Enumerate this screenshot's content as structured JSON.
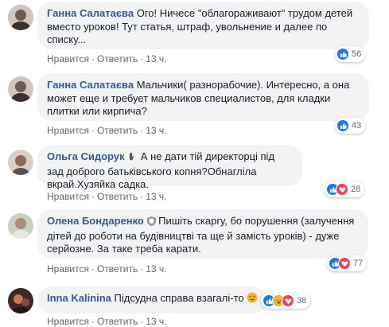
{
  "comments": [
    {
      "author": "Ганна Салатаєва",
      "text": "Ого! Ничесе \"облагораживают\" трудом детей вместо уроков! Тут статья, штраф, увольнение и далее по списку...",
      "like_label": "Нравится",
      "reply_label": "Ответить",
      "time": "13 ч.",
      "reaction_count": "56",
      "reactions": [
        "like"
      ],
      "avatar_color": "#8a7a70"
    },
    {
      "author": "Ганна Салатаєва",
      "text": "Мальчики( разнорабочие). Интересно, а она может еще и требует мальчиков специалистов, для кладки плитки или кирпича?",
      "like_label": "Нравится",
      "reply_label": "Ответить",
      "time": "13 ч.",
      "reaction_count": "43",
      "reactions": [
        "like"
      ],
      "avatar_color": "#8a7a70"
    },
    {
      "author": "Ольга Сидорук",
      "text": "А не дати тій директорці під зад доброго батьківського копня?Обнагліла вкрай.Хузяйка садка.",
      "like_label": "Нравится",
      "reply_label": "Ответить",
      "time": "13 ч.",
      "reaction_count": "28",
      "reactions": [
        "like",
        "love"
      ],
      "avatar_color": "#b0a08f"
    },
    {
      "author": "Олена Бондаренко",
      "text": "Пишіть скаргу, бо порушення (залучення дітей до роботи на будівництві та ще й замість уроків) - дуже серйозне. За таке треба карати.",
      "like_label": "Нравится",
      "reply_label": "Ответить",
      "time": "13 ч.",
      "reaction_count": "77",
      "reactions": [
        "like",
        "love"
      ],
      "avatar_color": "#9aa58a"
    },
    {
      "author": "Inna Kalinina",
      "text": "Підсудна справа взагалі-то",
      "like_label": "Нравится",
      "reply_label": "Ответить",
      "time": "13 ч.",
      "reaction_count": "38",
      "reactions": [
        "like",
        "haha",
        "love"
      ],
      "avatar_color": "#5a3a2a"
    }
  ],
  "colors": {
    "author": "#385898",
    "bubble": "#f2f3f5",
    "like": "#1877f2",
    "love": "#f33e58",
    "haha": "#f7b125"
  }
}
